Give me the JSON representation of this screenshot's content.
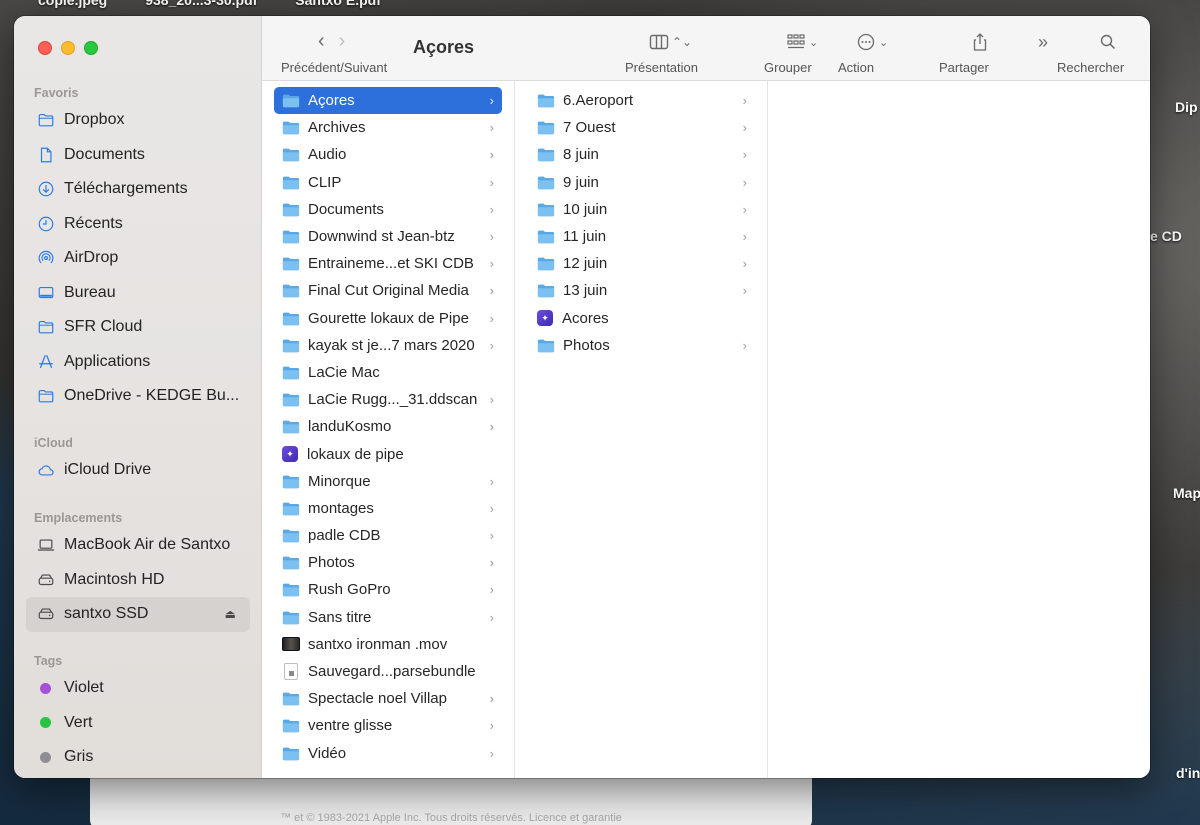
{
  "desktop": {
    "top_labels": [
      "copie.jpeg",
      "938_20...3-30.pdf",
      "Santxo E.pdf"
    ],
    "right_labels": [
      "Dip",
      "e  CD",
      "Map",
      "d'in"
    ],
    "about_copyright": "™ et © 1983-2021 Apple Inc. Tous droits réservés. Licence et garantie"
  },
  "toolbar": {
    "title": "Açores",
    "nav_label": "Précédent/Suivant",
    "presentation_label": "Présentation",
    "group_label": "Grouper",
    "action_label": "Action",
    "share_label": "Partager",
    "search_label": "Rechercher"
  },
  "sidebar": {
    "favorites_header": "Favoris",
    "favorites": [
      {
        "label": "Dropbox",
        "icon": "folder-icon"
      },
      {
        "label": "Documents",
        "icon": "document-icon"
      },
      {
        "label": "Téléchargements",
        "icon": "download-icon"
      },
      {
        "label": "Récents",
        "icon": "clock-icon"
      },
      {
        "label": "AirDrop",
        "icon": "airdrop-icon"
      },
      {
        "label": "Bureau",
        "icon": "desktop-icon"
      },
      {
        "label": "SFR Cloud",
        "icon": "folder-icon"
      },
      {
        "label": "Applications",
        "icon": "applications-icon"
      },
      {
        "label": "OneDrive - KEDGE Bu...",
        "icon": "folder-icon"
      }
    ],
    "icloud_header": "iCloud",
    "icloud": [
      {
        "label": "iCloud Drive",
        "icon": "cloud-icon"
      }
    ],
    "locations_header": "Emplacements",
    "locations": [
      {
        "label": "MacBook Air de Santxo",
        "icon": "laptop-icon"
      },
      {
        "label": "Macintosh HD",
        "icon": "disk-icon"
      },
      {
        "label": "santxo SSD",
        "icon": "disk-icon",
        "selected": true
      }
    ],
    "tags_header": "Tags",
    "tags": [
      {
        "label": "Violet",
        "color": "#a550d6"
      },
      {
        "label": "Vert",
        "color": "#27c43f"
      },
      {
        "label": "Gris",
        "color": "#8e8e93"
      }
    ]
  },
  "columns": {
    "col1": [
      {
        "label": "Açores",
        "kind": "folder",
        "selected": true
      },
      {
        "label": "Archives",
        "kind": "folder"
      },
      {
        "label": "Audio",
        "kind": "folder"
      },
      {
        "label": "CLIP",
        "kind": "folder"
      },
      {
        "label": "Documents",
        "kind": "folder"
      },
      {
        "label": "Downwind st Jean-btz",
        "kind": "folder"
      },
      {
        "label": "Entraineme...et SKI CDB",
        "kind": "folder"
      },
      {
        "label": "Final Cut Original Media",
        "kind": "folder"
      },
      {
        "label": "Gourette lokaux de Pipe",
        "kind": "folder"
      },
      {
        "label": "kayak st je...7 mars 2020",
        "kind": "folder"
      },
      {
        "label": "LaCie Mac",
        "kind": "folder-nochev"
      },
      {
        "label": "LaCie Rugg..._31.ddscan",
        "kind": "folder"
      },
      {
        "label": "landuKosmo",
        "kind": "folder"
      },
      {
        "label": "lokaux de pipe",
        "kind": "app"
      },
      {
        "label": "Minorque",
        "kind": "folder"
      },
      {
        "label": "montages",
        "kind": "folder"
      },
      {
        "label": "padle CDB",
        "kind": "folder"
      },
      {
        "label": "Photos",
        "kind": "folder"
      },
      {
        "label": "Rush GoPro",
        "kind": "folder"
      },
      {
        "label": "Sans titre",
        "kind": "folder"
      },
      {
        "label": "santxo ironman .mov",
        "kind": "movie"
      },
      {
        "label": "Sauvegard...parsebundle",
        "kind": "document"
      },
      {
        "label": "Spectacle noel Villap",
        "kind": "folder"
      },
      {
        "label": "ventre glisse",
        "kind": "folder"
      },
      {
        "label": "Vidéo",
        "kind": "folder"
      }
    ],
    "col2": [
      {
        "label": "6.Aeroport",
        "kind": "folder"
      },
      {
        "label": "7 Ouest",
        "kind": "folder"
      },
      {
        "label": "8 juin",
        "kind": "folder"
      },
      {
        "label": "9 juin",
        "kind": "folder"
      },
      {
        "label": "10 juin",
        "kind": "folder"
      },
      {
        "label": "11 juin",
        "kind": "folder"
      },
      {
        "label": "12 juin",
        "kind": "folder"
      },
      {
        "label": "13 juin",
        "kind": "folder"
      },
      {
        "label": "Acores",
        "kind": "app"
      },
      {
        "label": "Photos",
        "kind": "folder"
      }
    ]
  },
  "colors": {
    "selection": "#2d6fdb",
    "folder": "#5aa9e6"
  }
}
